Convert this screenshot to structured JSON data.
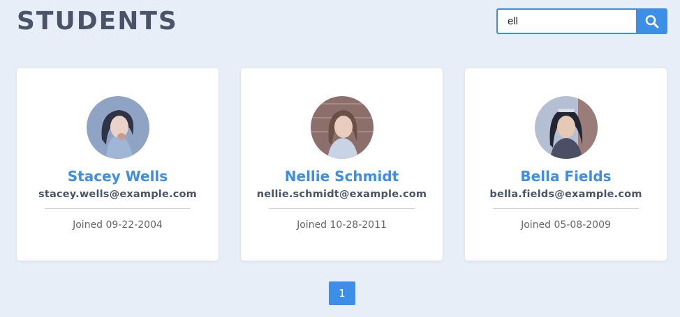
{
  "header": {
    "title": "STUDENTS"
  },
  "search": {
    "value": "ell",
    "icon": "search-icon"
  },
  "students": [
    {
      "name": "Stacey Wells",
      "email": "stacey.wells@example.com",
      "joined": "Joined 09-22-2004"
    },
    {
      "name": "Nellie Schmidt",
      "email": "nellie.schmidt@example.com",
      "joined": "Joined 10-28-2011"
    },
    {
      "name": "Bella Fields",
      "email": "bella.fields@example.com",
      "joined": "Joined 05-08-2009"
    }
  ],
  "pagination": {
    "current": "1"
  },
  "colors": {
    "accent": "#3d8ee6",
    "background": "#e8eef8",
    "title": "#4a5468"
  }
}
